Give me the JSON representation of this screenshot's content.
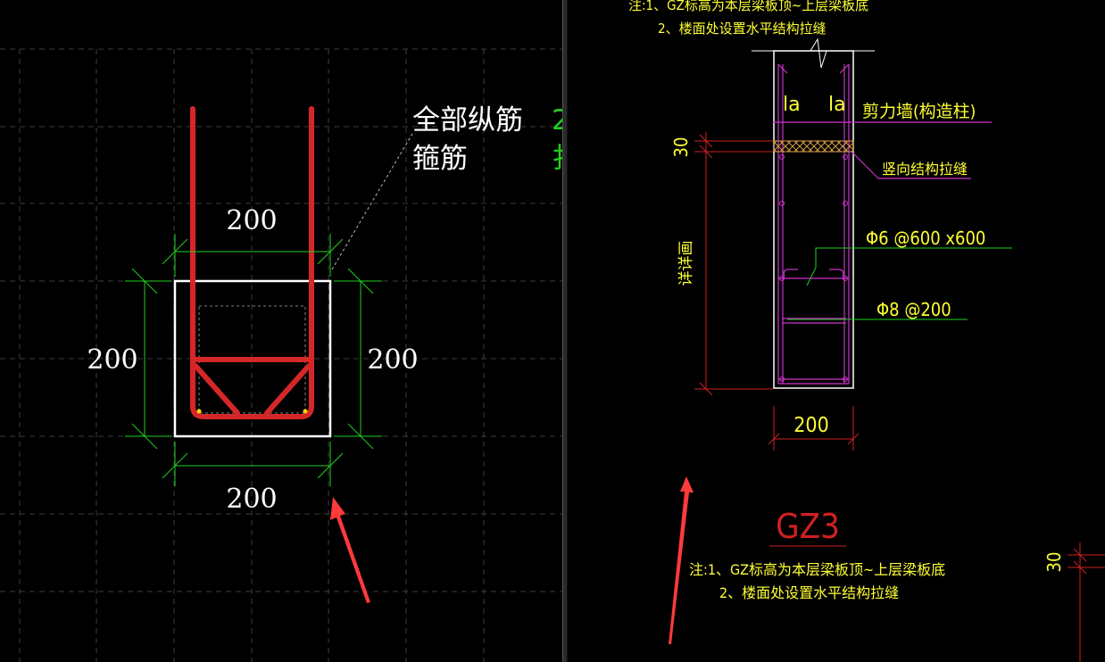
{
  "colors": {
    "background": "#000000",
    "grid": "#3c3c46",
    "rebar": "#d62728",
    "dimension": "#1fd01f",
    "text_white": "#ffffff",
    "text_yellow": "#ffff33",
    "magenta": "#cc33cc",
    "red_line": "#d02020",
    "arrow": "#ff3a3a"
  },
  "left": {
    "label_longitudinal": "全部纵筋",
    "label_stirrup": "箍筋",
    "longitudinal_value_partial": "2",
    "stirrup_value_partial": "扌",
    "dim_top": "200",
    "dim_left": "200",
    "dim_right": "200",
    "dim_bottom": "200"
  },
  "right": {
    "note_top_1": "注:1、GZ标高为本层梁板顶~上层梁板底",
    "note_top_2": "2、楼面处设置水平结构拉缝",
    "la_left": "la",
    "la_right": "la",
    "wall_label": "剪力墙(构造柱)",
    "joint_label": "竖向结构拉缝",
    "dim_30": "30",
    "height_label": "详详画",
    "tie_label": "Φ6 @600 x600",
    "stirrup_label": "Φ8 @200",
    "width_dim": "200",
    "title": "GZ3",
    "note_bottom_1": "注:1、GZ标高为本层梁板顶~上层梁板底",
    "note_bottom_2": "2、楼面处设置水平结构拉缝",
    "dim_30_right": "30"
  }
}
